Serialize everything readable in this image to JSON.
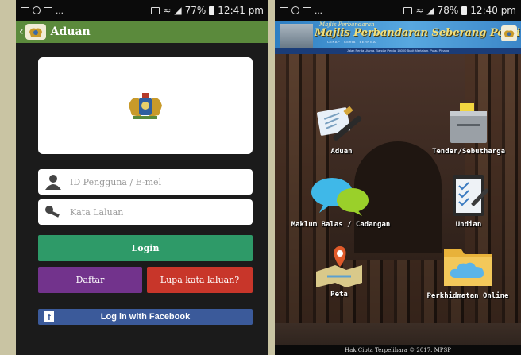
{
  "left_screen": {
    "status": {
      "time": "12:41 pm",
      "battery": "77%",
      "more": "..."
    },
    "header": {
      "back_glyph": "‹",
      "title": "Aduan"
    },
    "login": {
      "username_placeholder": "ID Pengguna / E-mel",
      "password_placeholder": "Kata Laluan",
      "login_label": "Login",
      "register_label": "Daftar",
      "forgot_label": "Lupa kata laluan?",
      "facebook_label": "Log in with Facebook",
      "facebook_glyph": "f"
    },
    "colors": {
      "header": "#5b8a3c",
      "login": "#2e9a68",
      "register": "#72338c",
      "forgot": "#c8362a",
      "facebook": "#3b5a9a"
    }
  },
  "right_screen": {
    "status": {
      "time": "12:40 pm",
      "battery": "78%",
      "more": "..."
    },
    "banner": {
      "script": "Majlis Perbandaran",
      "name": "Majlis Perbandaran Seberang Perai",
      "tagline": "CEKAP · CERIA · BERNILAI",
      "address": "Jalan Perda Utama, Bandar Perda, 14000 Bukit Mertajam, Pulau Pinang"
    },
    "menu": [
      {
        "id": "aduan",
        "label": "Aduan",
        "icon": "complaint-pen-icon"
      },
      {
        "id": "tender",
        "label": "Tender/Sebutharga",
        "icon": "ballot-box-icon"
      },
      {
        "id": "maklum",
        "label": "Maklum Balas / Cadangan",
        "icon": "chat-bubbles-icon"
      },
      {
        "id": "undian",
        "label": "Undian",
        "icon": "clipboard-checklist-icon"
      },
      {
        "id": "peta",
        "label": "Peta",
        "icon": "map-pin-icon"
      },
      {
        "id": "perkhidmatan",
        "label": "Perkhidmatan Online",
        "icon": "cloud-folder-icon"
      }
    ],
    "footer": "Hak Cipta Terpelihara © 2017. MPSP"
  }
}
